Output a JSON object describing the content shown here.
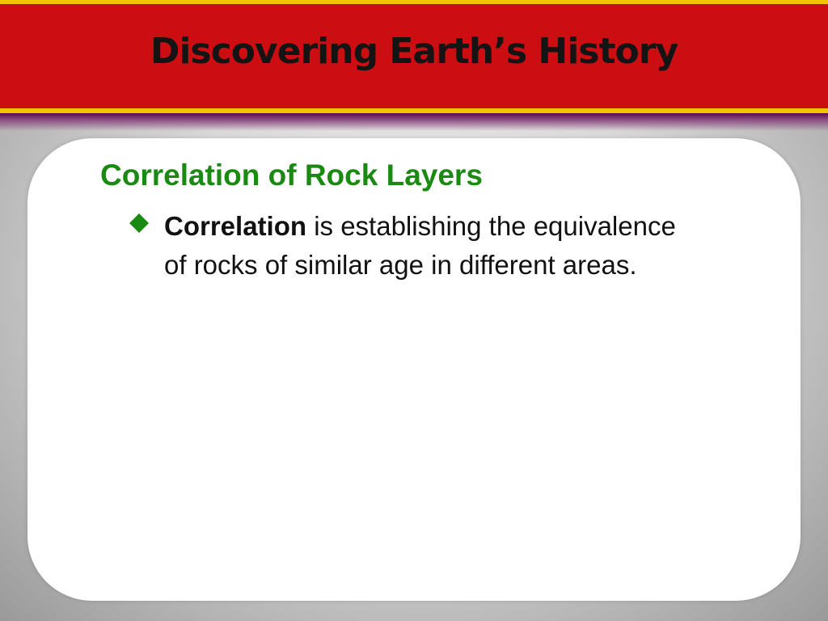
{
  "slide": {
    "title": "Discovering Earth’s History",
    "heading": "Correlation of Rock Layers",
    "bullet": {
      "icon": "diamond-bullet-icon",
      "term": "Correlation",
      "text_first_line": " is establishing the equivalence",
      "text_second_line": "of rocks of similar age in different areas."
    }
  },
  "colors": {
    "header_red": "#cc0e12",
    "header_stripe_gold": "#f2c300",
    "heading_green": "#1a8a12",
    "bullet_green": "#1a8a12"
  }
}
